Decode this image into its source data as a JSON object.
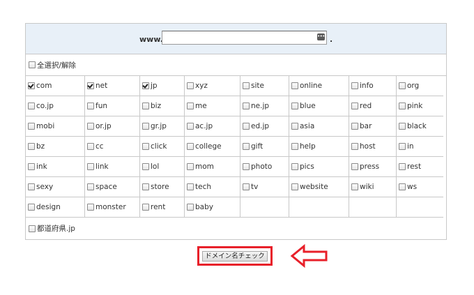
{
  "domain": {
    "prefix": "www.",
    "suffix": ".",
    "value": ""
  },
  "select_all": {
    "label": "全選択/解除",
    "checked": false
  },
  "tlds": [
    {
      "label": "com",
      "checked": true
    },
    {
      "label": "net",
      "checked": true
    },
    {
      "label": "jp",
      "checked": true
    },
    {
      "label": "xyz",
      "checked": false
    },
    {
      "label": "site",
      "checked": false
    },
    {
      "label": "online",
      "checked": false
    },
    {
      "label": "info",
      "checked": false
    },
    {
      "label": "org",
      "checked": false
    },
    {
      "label": "co.jp",
      "checked": false
    },
    {
      "label": "fun",
      "checked": false
    },
    {
      "label": "biz",
      "checked": false
    },
    {
      "label": "me",
      "checked": false
    },
    {
      "label": "ne.jp",
      "checked": false
    },
    {
      "label": "blue",
      "checked": false
    },
    {
      "label": "red",
      "checked": false
    },
    {
      "label": "pink",
      "checked": false
    },
    {
      "label": "mobi",
      "checked": false
    },
    {
      "label": "or.jp",
      "checked": false
    },
    {
      "label": "gr.jp",
      "checked": false
    },
    {
      "label": "ac.jp",
      "checked": false
    },
    {
      "label": "ed.jp",
      "checked": false
    },
    {
      "label": "asia",
      "checked": false
    },
    {
      "label": "bar",
      "checked": false
    },
    {
      "label": "black",
      "checked": false
    },
    {
      "label": "bz",
      "checked": false
    },
    {
      "label": "cc",
      "checked": false
    },
    {
      "label": "click",
      "checked": false
    },
    {
      "label": "college",
      "checked": false
    },
    {
      "label": "gift",
      "checked": false
    },
    {
      "label": "help",
      "checked": false
    },
    {
      "label": "host",
      "checked": false
    },
    {
      "label": "in",
      "checked": false
    },
    {
      "label": "ink",
      "checked": false
    },
    {
      "label": "link",
      "checked": false
    },
    {
      "label": "lol",
      "checked": false
    },
    {
      "label": "mom",
      "checked": false
    },
    {
      "label": "photo",
      "checked": false
    },
    {
      "label": "pics",
      "checked": false
    },
    {
      "label": "press",
      "checked": false
    },
    {
      "label": "rest",
      "checked": false
    },
    {
      "label": "sexy",
      "checked": false
    },
    {
      "label": "space",
      "checked": false
    },
    {
      "label": "store",
      "checked": false
    },
    {
      "label": "tech",
      "checked": false
    },
    {
      "label": "tv",
      "checked": false
    },
    {
      "label": "website",
      "checked": false
    },
    {
      "label": "wiki",
      "checked": false
    },
    {
      "label": "ws",
      "checked": false
    },
    {
      "label": "design",
      "checked": false
    },
    {
      "label": "monster",
      "checked": false
    },
    {
      "label": "rent",
      "checked": false
    },
    {
      "label": "baby",
      "checked": false
    }
  ],
  "prefecture": {
    "label": "都道府県.jp",
    "checked": false
  },
  "check_button": {
    "label": "ドメイン名チェック"
  },
  "colors": {
    "highlight": "#e8202a",
    "header_bg": "#e8f0f8"
  },
  "icons": {
    "annotation": "left-arrow-icon"
  }
}
